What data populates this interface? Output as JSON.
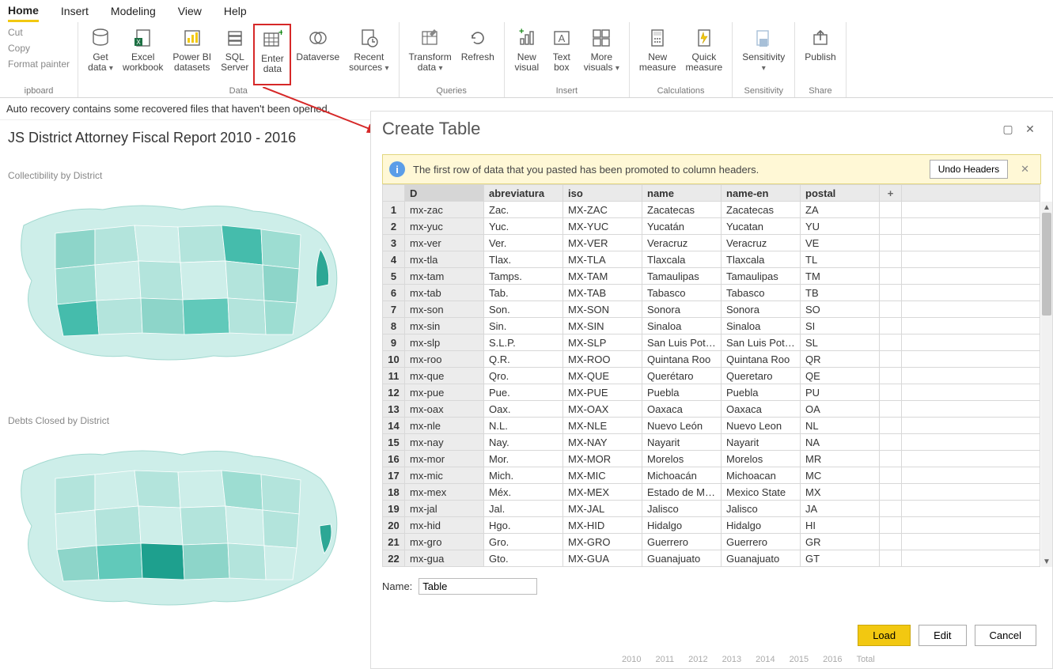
{
  "tabs": [
    "Home",
    "Insert",
    "Modeling",
    "View",
    "Help"
  ],
  "activeTab": "Home",
  "clipboard": {
    "cut": "Cut",
    "copy": "Copy",
    "formatPainter": "Format painter",
    "label": "ipboard"
  },
  "ribbon": {
    "data": {
      "label": "Data",
      "getData": "Get\ndata",
      "excel": "Excel\nworkbook",
      "powerbi": "Power BI\ndatasets",
      "sql": "SQL\nServer",
      "enter": "Enter\ndata",
      "dataverse": "Dataverse",
      "recent": "Recent\nsources"
    },
    "queries": {
      "label": "Queries",
      "transform": "Transform\ndata",
      "refresh": "Refresh"
    },
    "insert": {
      "label": "Insert",
      "newvisual": "New\nvisual",
      "textbox": "Text\nbox",
      "morevisuals": "More\nvisuals"
    },
    "calc": {
      "label": "Calculations",
      "newmeasure": "New\nmeasure",
      "quick": "Quick\nmeasure"
    },
    "sens": {
      "label": "Sensitivity",
      "sensitivity": "Sensitivity"
    },
    "share": {
      "label": "Share",
      "publish": "Publish"
    }
  },
  "autorecovery": "Auto recovery contains some recovered files that haven't been opened.",
  "report": {
    "title": "JS District Attorney Fiscal Report 2010 - 2016",
    "chart1": "Collectibility by District",
    "chart2": "Debts Closed by District"
  },
  "dialog": {
    "title": "Create Table",
    "infoMsg": "The first row of data that you pasted has been promoted to column headers.",
    "undo": "Undo Headers",
    "nameLabel": "Name:",
    "nameValue": "Table",
    "load": "Load",
    "edit": "Edit",
    "cancel": "Cancel",
    "columns": [
      "D",
      "abreviatura",
      "iso",
      "name",
      "name-en",
      "postal"
    ],
    "rows": [
      [
        "mx-zac",
        "Zac.",
        "MX-ZAC",
        "Zacatecas",
        "Zacatecas",
        "ZA"
      ],
      [
        "mx-yuc",
        "Yuc.",
        "MX-YUC",
        "Yucatán",
        "Yucatan",
        "YU"
      ],
      [
        "mx-ver",
        "Ver.",
        "MX-VER",
        "Veracruz",
        "Veracruz",
        "VE"
      ],
      [
        "mx-tla",
        "Tlax.",
        "MX-TLA",
        "Tlaxcala",
        "Tlaxcala",
        "TL"
      ],
      [
        "mx-tam",
        "Tamps.",
        "MX-TAM",
        "Tamaulipas",
        "Tamaulipas",
        "TM"
      ],
      [
        "mx-tab",
        "Tab.",
        "MX-TAB",
        "Tabasco",
        "Tabasco",
        "TB"
      ],
      [
        "mx-son",
        "Son.",
        "MX-SON",
        "Sonora",
        "Sonora",
        "SO"
      ],
      [
        "mx-sin",
        "Sin.",
        "MX-SIN",
        "Sinaloa",
        "Sinaloa",
        "SI"
      ],
      [
        "mx-slp",
        "S.L.P.",
        "MX-SLP",
        "San Luis Potosí",
        "San Luis Potosi",
        "SL"
      ],
      [
        "mx-roo",
        "Q.R.",
        "MX-ROO",
        "Quintana Roo",
        "Quintana Roo",
        "QR"
      ],
      [
        "mx-que",
        "Qro.",
        "MX-QUE",
        "Querétaro",
        "Queretaro",
        "QE"
      ],
      [
        "mx-pue",
        "Pue.",
        "MX-PUE",
        "Puebla",
        "Puebla",
        "PU"
      ],
      [
        "mx-oax",
        "Oax.",
        "MX-OAX",
        "Oaxaca",
        "Oaxaca",
        "OA"
      ],
      [
        "mx-nle",
        "N.L.",
        "MX-NLE",
        "Nuevo León",
        "Nuevo Leon",
        "NL"
      ],
      [
        "mx-nay",
        "Nay.",
        "MX-NAY",
        "Nayarit",
        "Nayarit",
        "NA"
      ],
      [
        "mx-mor",
        "Mor.",
        "MX-MOR",
        "Morelos",
        "Morelos",
        "MR"
      ],
      [
        "mx-mic",
        "Mich.",
        "MX-MIC",
        "Michoacán",
        "Michoacan",
        "MC"
      ],
      [
        "mx-mex",
        "Méx.",
        "MX-MEX",
        "Estado de Méxi…",
        "Mexico State",
        "MX"
      ],
      [
        "mx-jal",
        "Jal.",
        "MX-JAL",
        "Jalisco",
        "Jalisco",
        "JA"
      ],
      [
        "mx-hid",
        "Hgo.",
        "MX-HID",
        "Hidalgo",
        "Hidalgo",
        "HI"
      ],
      [
        "mx-gro",
        "Gro.",
        "MX-GRO",
        "Guerrero",
        "Guerrero",
        "GR"
      ],
      [
        "mx-gua",
        "Gto.",
        "MX-GUA",
        "Guanajuato",
        "Guanajuato",
        "GT"
      ]
    ]
  },
  "years": [
    "2010",
    "2011",
    "2012",
    "2013",
    "2014",
    "2015",
    "2016",
    "Total"
  ]
}
